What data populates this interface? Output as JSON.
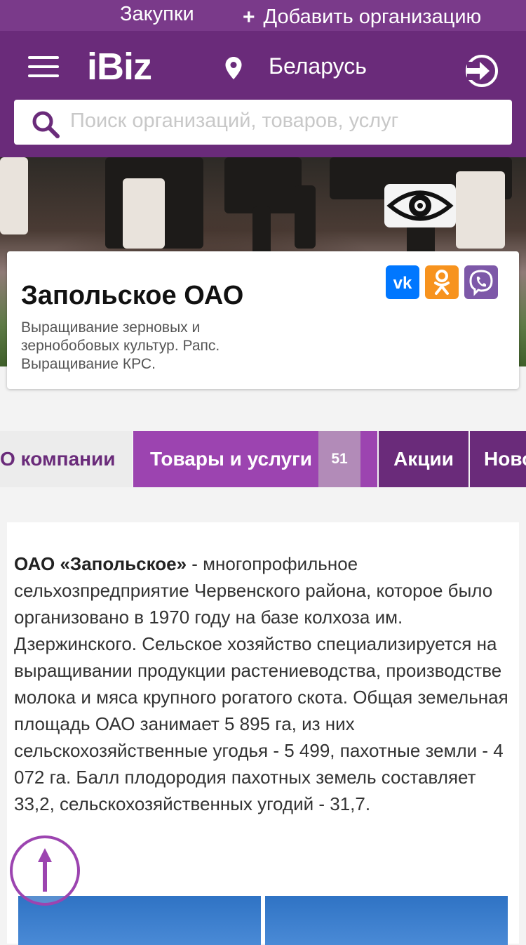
{
  "topbar": {
    "procurement": "Закупки",
    "add_org": "Добавить организацию"
  },
  "header": {
    "logo": "iBiz",
    "region": "Беларусь",
    "search_placeholder": "Поиск организаций, товаров, услуг"
  },
  "company": {
    "name": "Запольское ОАО",
    "description": "Выращивание зерновых и зернобобовых культур. Рапс. Выращивание КРС."
  },
  "tabs": {
    "about": "О компании",
    "goods": "Товары и услуги",
    "goods_count": "51",
    "promo": "Акции",
    "news": "Новости"
  },
  "about": {
    "bold_intro": "ОАО «Запольское»",
    "text": " - многопрофильное сельхозпредприятие Червенского района, которое было организовано в 1970 году на базе колхоза им. Дзержинского. Сельское хозяйство специализируется на выращивании продукции растениеводства, производстве молока и мяса крупного рогатого скота. Общая земельная площадь ОАО занимает 5 895 га, из них сельскохозяйственные угодья - 5 499, пахотные земли - 4 072 га. Балл плодородия пахотных земель составляет 33,2, сельскохозяйственных угодий - 31,7."
  },
  "icons": [
    "plus-icon",
    "menu-icon",
    "location-pin-icon",
    "login-icon",
    "search-icon",
    "eye-icon",
    "vk-icon",
    "odnoklassniki-icon",
    "viber-icon",
    "arrow-up-icon"
  ],
  "colors": {
    "brand": "#6a2b7a",
    "accent": "#9c44b0"
  }
}
